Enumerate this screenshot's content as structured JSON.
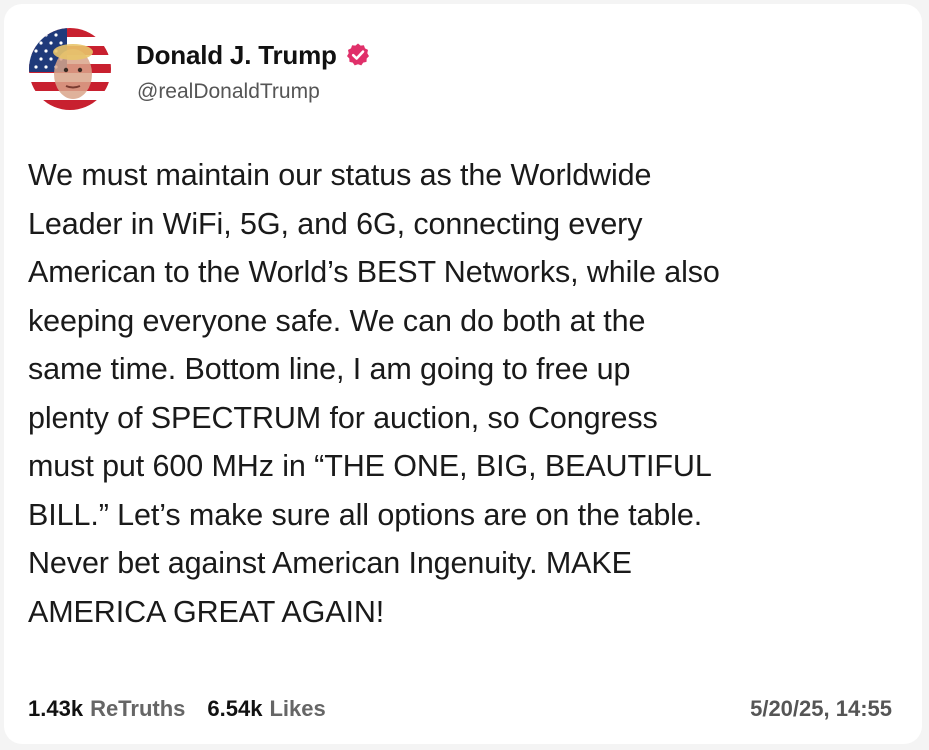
{
  "post": {
    "author": {
      "display_name": "Donald J. Trump",
      "handle": "@realDonaldTrump",
      "verified": true,
      "avatar_icon": "flag-portrait-avatar"
    },
    "text": "We must maintain our status as the Worldwide\nLeader in WiFi, 5G, and 6G, connecting every\nAmerican to the World’s BEST Networks, while also\nkeeping everyone safe. We can do both at the\nsame time. Bottom line, I am going to free up\nplenty of SPECTRUM for auction, so Congress\nmust put 600 MHz in “THE ONE, BIG, BEAUTIFUL\nBILL.” Let’s make sure all options are on the table.\nNever bet against American Ingenuity. MAKE\nAMERICA GREAT AGAIN!",
    "stats": {
      "retruths_count": "1.43k",
      "retruths_label": "ReTruths",
      "likes_count": "6.54k",
      "likes_label": "Likes"
    },
    "timestamp": "5/20/25, 14:55"
  },
  "colors": {
    "verified_badge": "#e0306a",
    "flag_red": "#c8202f",
    "flag_blue": "#1f3a7a"
  }
}
